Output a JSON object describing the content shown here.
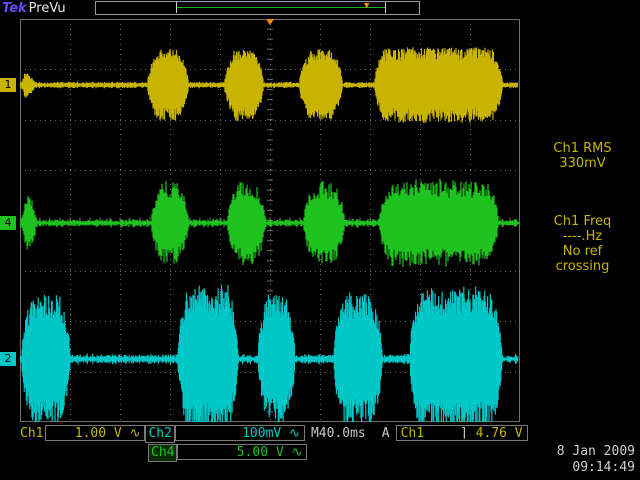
{
  "topbar": {
    "brand": "Tek",
    "mode": "PreVu"
  },
  "channels": [
    {
      "id": "ch1",
      "marker": "1",
      "label": "Ch1",
      "scale": "1.00 V",
      "coupling_symbol": "∿",
      "color": "#c8b400"
    },
    {
      "id": "ch4",
      "marker": "4",
      "label": "Ch4",
      "scale": "5.00 V",
      "coupling_symbol": "∿",
      "color": "#1fc31f"
    },
    {
      "id": "ch2",
      "marker": "2",
      "label": "Ch2",
      "scale": "100mV",
      "coupling_symbol": "∿",
      "color": "#00c8c8"
    }
  ],
  "horizontal": {
    "timebase": "M40.0ms"
  },
  "trigger": {
    "mode_label": "A",
    "source": "Ch1",
    "slope_symbol": "⌉",
    "level": "4.76 V"
  },
  "measurements": {
    "rms": {
      "title": "Ch1 RMS",
      "value": "330mV"
    },
    "freq": {
      "title": "Ch1 Freq",
      "value": "----.Hz",
      "note_line1": "No ref",
      "note_line2": "crossing"
    }
  },
  "datetime": {
    "date": "8 Jan  2009",
    "time": "09:14:49"
  },
  "colors": {
    "ch1": "#c8b400",
    "ch2": "#00c8c8",
    "ch4": "#1fc31f",
    "grid": "#6e6e6e",
    "trigger_marker": "#ff8a00"
  }
}
